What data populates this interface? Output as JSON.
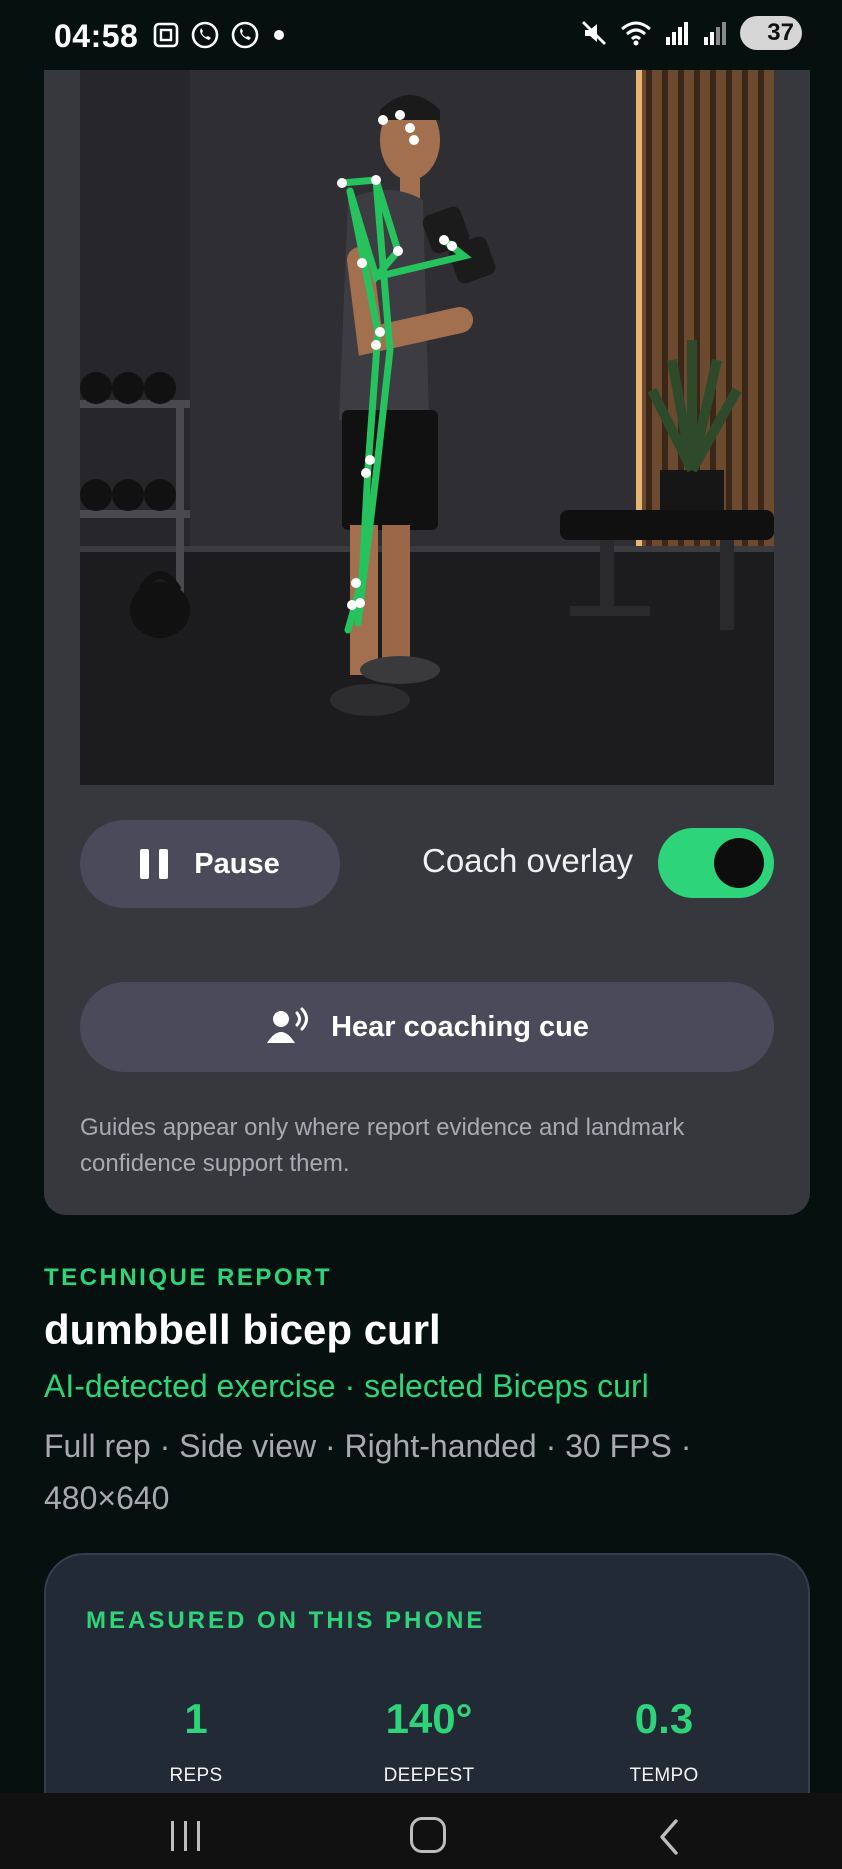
{
  "status_bar": {
    "time": "04:58",
    "battery": "37",
    "left_icons": [
      "screenshot-icon",
      "whatsapp-icon",
      "whatsapp-icon",
      "dot-icon"
    ],
    "right_icons": [
      "mute-icon",
      "wifi-icon",
      "signal-icon",
      "signal-icon",
      "battery-icon"
    ]
  },
  "player": {
    "pause_label": "Pause",
    "overlay_label": "Coach overlay",
    "overlay_enabled": true,
    "cue_label": "Hear coaching cue",
    "guide_note": "Guides appear only where report evidence and landmark confidence support them."
  },
  "report": {
    "kicker": "TECHNIQUE REPORT",
    "title": "dumbbell bicep curl",
    "detection": "AI-detected exercise · selected Biceps curl",
    "meta": "Full rep · Side view · Right-handed · 30 FPS · 480×640"
  },
  "measurements": {
    "kicker": "MEASURED ON THIS PHONE",
    "stats": [
      {
        "value": "1",
        "label": "REPS"
      },
      {
        "value": "140°",
        "label": "DEEPEST"
      },
      {
        "value": "0.3",
        "label": "TEMPO"
      }
    ]
  },
  "colors": {
    "accent": "#2ed47a",
    "card": "#37373e",
    "button": "#4b4a5b",
    "background": "#06100f",
    "measure_card": "#222a35"
  }
}
